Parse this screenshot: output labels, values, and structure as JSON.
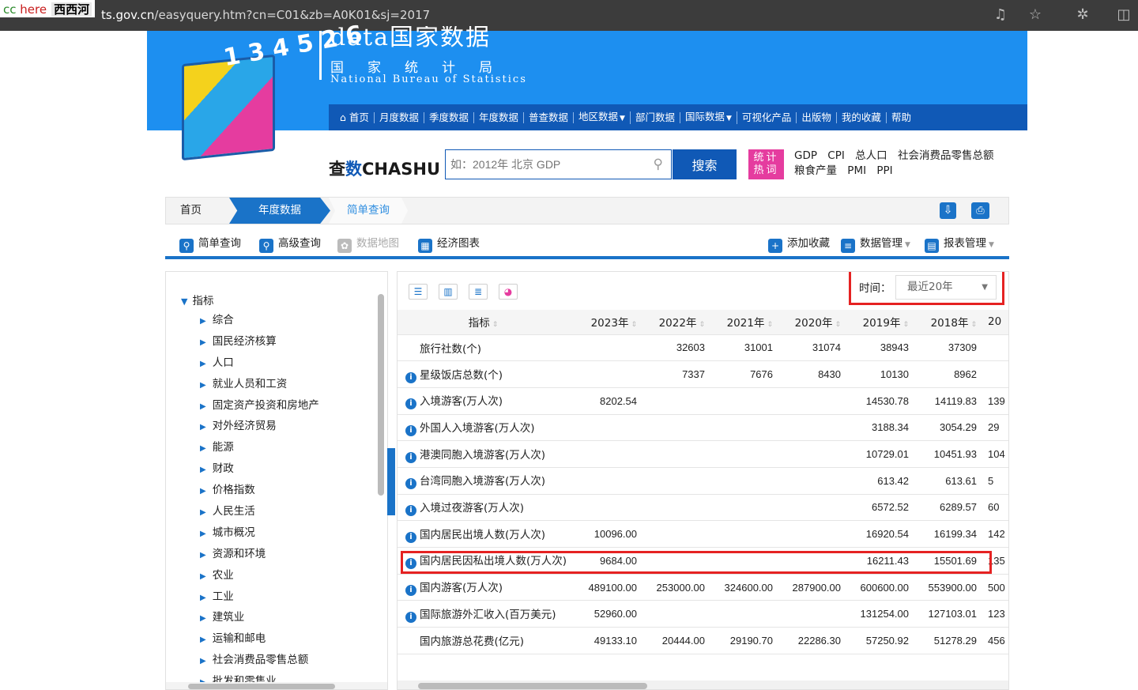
{
  "browser": {
    "url_prefix": "",
    "url_host": "ts.gov.cn",
    "url_path": "/easyquery.htm?cn=C01&zb=A0K01&sj=2017",
    "overlay_cc": "cc",
    "overlay_here": "here",
    "overlay_site": "西西河"
  },
  "header": {
    "logo_digits": "1 3 4 5 2 6",
    "site_title": "data国家数据",
    "site_cn": "国家统计局",
    "site_en": "National Bureau of Statistics"
  },
  "nav": {
    "items": [
      "首页",
      "月度数据",
      "季度数据",
      "年度数据",
      "普查数据",
      "地区数据",
      "部门数据",
      "国际数据",
      "可视化产品",
      "出版物",
      "我的收藏",
      "帮助"
    ]
  },
  "search": {
    "logo_dark": "查",
    "logo_blue": "数",
    "logo_latin": "CHASHU",
    "placeholder": "如：2012年 北京 GDP",
    "button_label": "搜索",
    "hot_badge": "统计热词",
    "hot_words": [
      "GDP",
      "CPI",
      "总人口",
      "社会消费品零售总额",
      "粮食产量",
      "PMI",
      "PPI"
    ]
  },
  "breadcrumb": {
    "home": "首页",
    "year": "年度数据",
    "simple": "简单查询"
  },
  "toolbar": {
    "simple_query": "简单查询",
    "advanced_query": "高级查询",
    "data_map": "数据地图",
    "econ_chart": "经济图表",
    "add_favorite": "添加收藏",
    "data_manage": "数据管理",
    "report_manage": "报表管理"
  },
  "sidebar": {
    "root": "指标",
    "items": [
      "综合",
      "国民经济核算",
      "人口",
      "就业人员和工资",
      "固定资产投资和房地产",
      "对外经济贸易",
      "能源",
      "财政",
      "价格指数",
      "人民生活",
      "城市概况",
      "资源和环境",
      "农业",
      "工业",
      "建筑业",
      "运输和邮电",
      "社会消费品零售总额",
      "批发和零售业"
    ]
  },
  "time_filter": {
    "label": "时间：",
    "value": "最近20年"
  },
  "table": {
    "headers": [
      "指标",
      "2023年",
      "2022年",
      "2021年",
      "2020年",
      "2019年",
      "2018年",
      "20"
    ],
    "rows": [
      {
        "info": false,
        "name": "旅行社数(个)",
        "values": [
          "",
          "32603",
          "31001",
          "31074",
          "38943",
          "37309",
          ""
        ]
      },
      {
        "info": true,
        "name": "星级饭店总数(个)",
        "values": [
          "",
          "7337",
          "7676",
          "8430",
          "10130",
          "8962",
          ""
        ]
      },
      {
        "info": true,
        "name": "入境游客(万人次)",
        "values": [
          "8202.54",
          "",
          "",
          "",
          "14530.78",
          "14119.83",
          "139"
        ]
      },
      {
        "info": true,
        "name": "外国人入境游客(万人次)",
        "values": [
          "",
          "",
          "",
          "",
          "3188.34",
          "3054.29",
          "29"
        ]
      },
      {
        "info": true,
        "name": "港澳同胞入境游客(万人次)",
        "values": [
          "",
          "",
          "",
          "",
          "10729.01",
          "10451.93",
          "104"
        ]
      },
      {
        "info": true,
        "name": "台湾同胞入境游客(万人次)",
        "values": [
          "",
          "",
          "",
          "",
          "613.42",
          "613.61",
          "5"
        ]
      },
      {
        "info": true,
        "name": "入境过夜游客(万人次)",
        "values": [
          "",
          "",
          "",
          "",
          "6572.52",
          "6289.57",
          "60"
        ]
      },
      {
        "info": true,
        "name": "国内居民出境人数(万人次)",
        "values": [
          "10096.00",
          "",
          "",
          "",
          "16920.54",
          "16199.34",
          "142"
        ]
      },
      {
        "info": true,
        "name": "国内居民因私出境人数(万人次)",
        "values": [
          "9684.00",
          "",
          "",
          "",
          "16211.43",
          "15501.69",
          "135"
        ]
      },
      {
        "info": true,
        "name": "国内游客(万人次)",
        "values": [
          "489100.00",
          "253000.00",
          "324600.00",
          "287900.00",
          "600600.00",
          "553900.00",
          "500"
        ]
      },
      {
        "info": true,
        "name": "国际旅游外汇收入(百万美元)",
        "values": [
          "52960.00",
          "",
          "",
          "",
          "131254.00",
          "127103.01",
          "123"
        ]
      },
      {
        "info": false,
        "name": "国内旅游总花费(亿元)",
        "values": [
          "49133.10",
          "20444.00",
          "29190.70",
          "22286.30",
          "57250.92",
          "51278.29",
          "456"
        ]
      }
    ]
  }
}
